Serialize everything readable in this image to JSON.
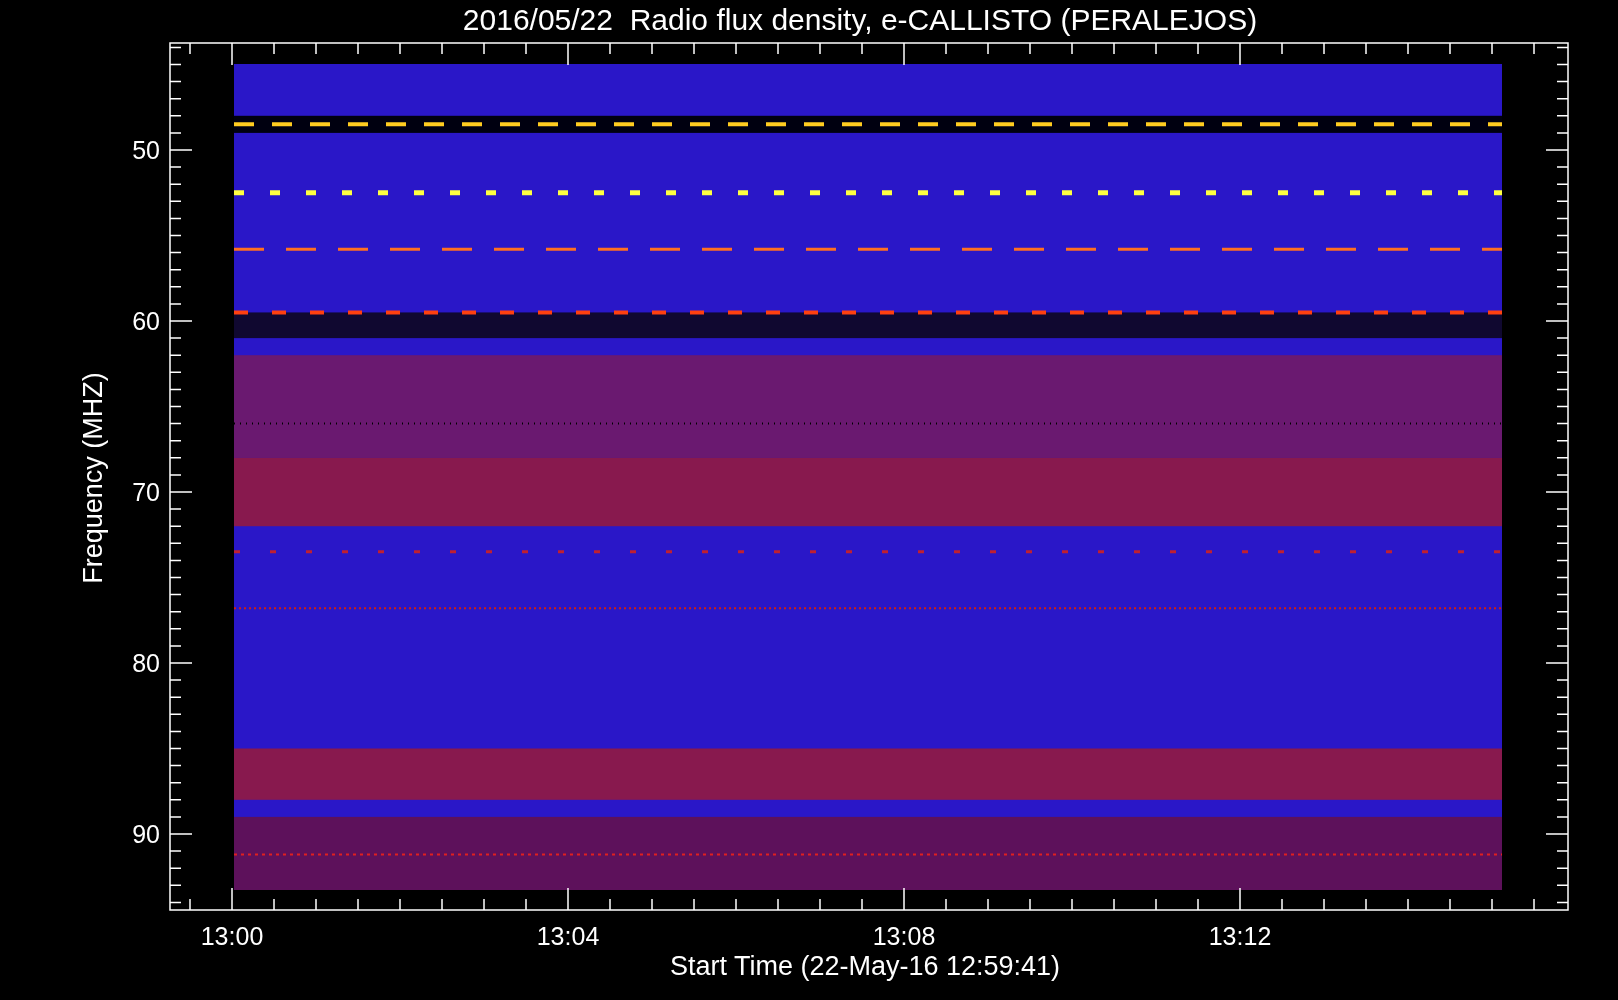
{
  "title": "2016/05/22  Radio flux density, e-CALLISTO (PERALEJOS)",
  "y_axis": {
    "label": "Frequency (MHZ)",
    "ticks": [
      "50",
      "60",
      "70",
      "80",
      "90"
    ]
  },
  "x_axis": {
    "label": "Start Time (22-May-16 12:59:41)",
    "ticks": [
      "13:00",
      "13:04",
      "13:08",
      "13:12"
    ]
  }
}
